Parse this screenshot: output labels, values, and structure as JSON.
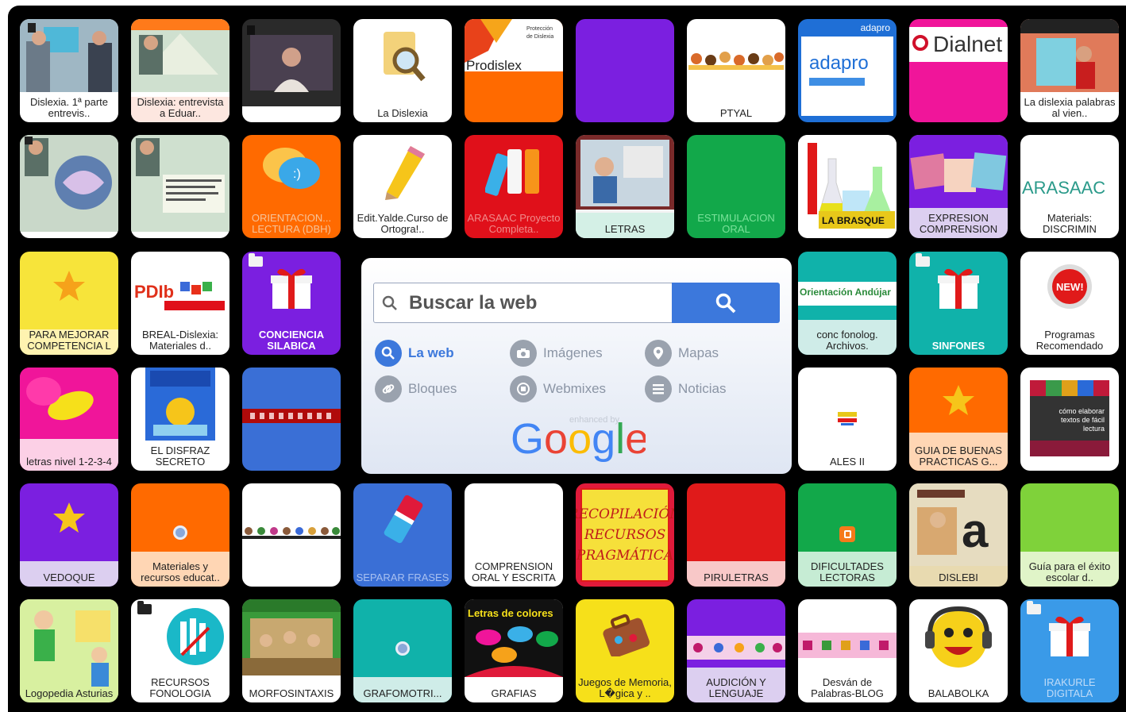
{
  "tiles": [
    {
      "label": "Dislexia. 1ª parte entrevis.."
    },
    {
      "label": "Dislexia: entrevista a Eduar.."
    },
    {
      "label": ""
    },
    {
      "label": "La Dislexia"
    },
    {
      "label": "",
      "brand": "Prodislex"
    },
    {
      "label": ""
    },
    {
      "label": "PTYAL"
    },
    {
      "label": "",
      "brand": "adapro"
    },
    {
      "label": "",
      "brand": "Dialnet"
    },
    {
      "label": "La dislexia palabras al vien.."
    },
    {
      "label": ""
    },
    {
      "label": ""
    },
    {
      "label": "ORIENTACION... LECTURA (DBH)"
    },
    {
      "label": "Edit.Yalde.Curso de Ortogra!.."
    },
    {
      "label": "ARASAAC Proyecto Completa.."
    },
    {
      "label": "LETRAS"
    },
    {
      "label": "ESTIMULACION ORAL"
    },
    {
      "label": "",
      "art": "LA BRASQUE"
    },
    {
      "label": "EXPRESION COMPRENSION"
    },
    {
      "label": "Materials: DISCRIMIN",
      "brand": "ARASAAC"
    },
    {
      "label": "PARA MEJORAR COMPETENCIA L"
    },
    {
      "label": "BREAL-Dislexia: Materiales d.."
    },
    {
      "label": "CONCIENCIA SILABICA"
    },
    {
      "label": "conc fonolog. Archivos.",
      "brand": "Orientación Andújar"
    },
    {
      "label": "SINFONES"
    },
    {
      "label": "Programas Recomendado",
      "badge": "NEW!"
    },
    {
      "label": "letras nivel 1-2-3-4"
    },
    {
      "label": "EL DISFRAZ SECRETO"
    },
    {
      "label": ""
    },
    {
      "label": "ALES II"
    },
    {
      "label": "GUIA DE BUENAS PRACTICAS G..."
    },
    {
      "label": "",
      "art": "cómo elaborar textos de fácil lectura"
    },
    {
      "label": "VEDOQUE"
    },
    {
      "label": "Materiales y recursos educat.."
    },
    {
      "label": ""
    },
    {
      "label": "SEPARAR FRASES"
    },
    {
      "label": "COMPRENSION ORAL Y ESCRITA"
    },
    {
      "label": "",
      "art": "RECOPILACIÓN RECURSOS PRAGMÁTICA"
    },
    {
      "label": "PIRULETRAS"
    },
    {
      "label": "DIFICULTADES LECTORAS"
    },
    {
      "label": "DISLEBI"
    },
    {
      "label": "Guía para el éxito escolar d.."
    },
    {
      "label": "Logopedia Asturias"
    },
    {
      "label": "RECURSOS FONOLOGIA"
    },
    {
      "label": "MORFOSINTAXIS"
    },
    {
      "label": "GRAFOMOTRI..."
    },
    {
      "label": "GRAFIAS",
      "art": "Letras de colores"
    },
    {
      "label": "Juegos de Memoria, L�gica y .."
    },
    {
      "label": "AUDICIÓN Y LENGUAJE"
    },
    {
      "label": "Desván de Palabras-BLOG"
    },
    {
      "label": "BALABOLKA"
    },
    {
      "label": "IRAKURLE DIGITALA"
    }
  ],
  "search": {
    "placeholder": "Buscar la web",
    "options": [
      {
        "label": "La web"
      },
      {
        "label": "Imágenes"
      },
      {
        "label": "Mapas"
      },
      {
        "label": "Bloques"
      },
      {
        "label": "Webmixes"
      },
      {
        "label": "Noticias"
      }
    ],
    "enhanced": "enhanced by",
    "google": "Google"
  },
  "colors": {
    "board": "#000000",
    "search_accent": "#3c78dc",
    "orange": "#ff6a00",
    "purple": "#7b1fe0",
    "green": "#12a84a",
    "magenta": "#f0159a",
    "teal": "#10b2aa",
    "blue": "#3a6fd6"
  }
}
